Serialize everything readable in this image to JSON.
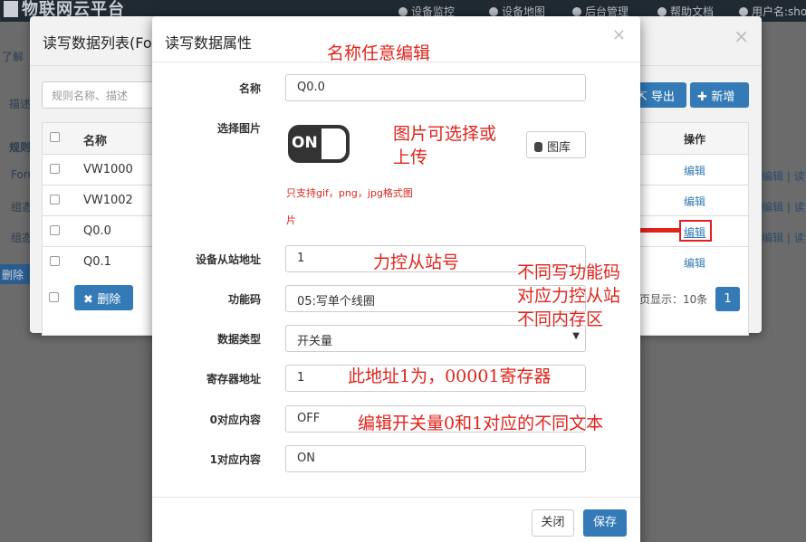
{
  "navbar": {
    "brand": "物联网云平台",
    "items": [
      "设备监控",
      "设备地图",
      "后台管理",
      "帮助文档",
      "用户名:sho"
    ]
  },
  "background": {
    "strip_texts": [
      "了解",
      "描述",
      "规则",
      "Forr",
      "组态",
      "组态"
    ],
    "right_links": [
      "编辑 | 读写",
      "编辑 | 读写",
      "编辑 | 读写"
    ],
    "delete_label": "删除"
  },
  "list_modal": {
    "title": "读写数据列表(Fo",
    "search_placeholder": "规则名称、描述",
    "export_label": "导出",
    "add_label": "新增",
    "columns": [
      "名称",
      "操作"
    ],
    "rows": [
      {
        "name": "VW1000",
        "op": "编辑"
      },
      {
        "name": "VW1002",
        "op": "编辑"
      },
      {
        "name": "Q0.0",
        "op": "编辑"
      },
      {
        "name": "Q0.1",
        "op": "编辑"
      }
    ],
    "delete_label": "删除",
    "page_info": "页显示：10条",
    "page_number": "1"
  },
  "edit_modal": {
    "title": "读写数据属性",
    "fields": {
      "name": {
        "label": "名称",
        "value": "Q0.0"
      },
      "image": {
        "label": "选择图片",
        "switch_text": "ON",
        "gallery_label": "图库",
        "note_line1": "只支持gif，png，jpg格式图",
        "note_line2": "片"
      },
      "slave": {
        "label": "设备从站地址",
        "value": "1"
      },
      "func": {
        "label": "功能码",
        "value": "05:写单个线圈"
      },
      "dtype": {
        "label": "数据类型",
        "value": "开关量"
      },
      "reg": {
        "label": "寄存器地址",
        "value": "1"
      },
      "zero": {
        "label": "0对应内容",
        "value": "OFF"
      },
      "one": {
        "label": "1对应内容",
        "value": "ON"
      }
    },
    "close_label": "关闭",
    "save_label": "保存"
  },
  "annotations": {
    "name": "名称任意编辑",
    "image_line1": "图片可选择或",
    "image_line2": "上传",
    "slave": "力控从站号",
    "func_line1": "不同写功能码",
    "func_line2": "对应力控从站",
    "func_line3": "不同内存区",
    "reg": "此地址1为，00001寄存器",
    "text": "编辑开关量0和1对应的不同文本"
  },
  "colors": {
    "primary": "#337ab7",
    "annotation": "#e0241c"
  }
}
